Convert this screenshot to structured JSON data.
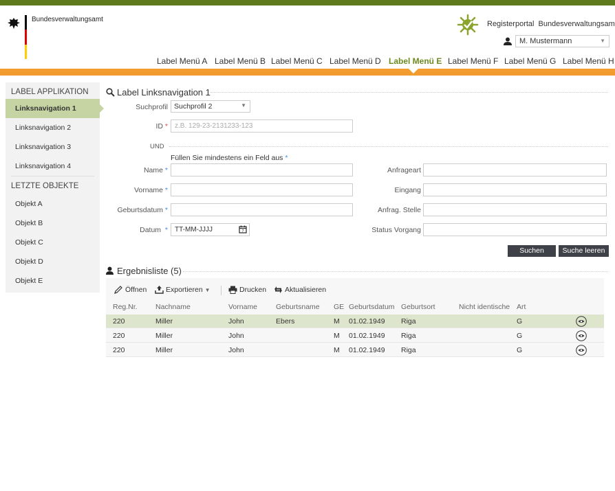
{
  "header": {
    "agency": "Bundesverwaltungsamt",
    "portal": "Registerportal",
    "portal_agency": "Bundesverwaltungsamt",
    "user": "M. Mustermann"
  },
  "mainnav": [
    "Label Menü A",
    "Label Menü B",
    "Label Menü C",
    "Label Menü D",
    "Label Menü E",
    "Label Menü F",
    "Label Menü G",
    "Label Menü H"
  ],
  "sidebar": {
    "app_heading": "LABEL APPLIKATION",
    "nav": [
      "Linksnavigation 1",
      "Linksnavigation 2",
      "Linksnavigation 3",
      "Linksnavigation 4"
    ],
    "objects_heading": "LETZTE OBJEKTE",
    "objects": [
      "Objekt A",
      "Objekt B",
      "Objekt C",
      "Objekt D",
      "Objekt E"
    ]
  },
  "search": {
    "title": "Label Linksnavigation 1",
    "profile_label": "Suchprofil",
    "profile_value": "Suchprofil 2",
    "id_label": "ID",
    "id_placeholder": "z.B. 129-23-2131233-123",
    "und": "UND",
    "hint": "Füllen Sie mindestens ein Feld aus",
    "name_label": "Name",
    "vorname_label": "Vorname",
    "geburtsdatum_label": "Geburtsdatum",
    "datum_label": "Datum",
    "datum_value": "TT-MM-JJJJ",
    "anfrageart_label": "Anfrageart",
    "eingang_label": "Eingang",
    "stelle_label": "Anfrag. Stelle",
    "status_label": "Status Vorgang",
    "search_button": "Suchen",
    "clear_button": "Suche leeren"
  },
  "results": {
    "title": "Ergebnisliste (5)",
    "toolbar": {
      "open": "Öffnen",
      "export": "Exportieren",
      "print": "Drucken",
      "refresh": "Aktualisieren"
    },
    "columns": [
      "Reg.Nr.",
      "Nachname",
      "Vorname",
      "Geburtsname",
      "GE",
      "Geburtsdatum",
      "Geburtsort",
      "Nicht identische",
      "Art"
    ],
    "rows": [
      [
        "220",
        "Miller",
        "John",
        "Ebers",
        "M",
        "01.02.1949",
        "Riga",
        "",
        "G"
      ],
      [
        "220",
        "Miller",
        "John",
        "",
        "M",
        "01.02.1949",
        "Riga",
        "",
        "G"
      ],
      [
        "220",
        "Miller",
        "John",
        "",
        "M",
        "01.02.1949",
        "Riga",
        "",
        "G"
      ]
    ]
  },
  "colors": {
    "accent_green": "#6c8a1f",
    "orange": "#f29b2f",
    "selected_row": "#dde6cc"
  }
}
